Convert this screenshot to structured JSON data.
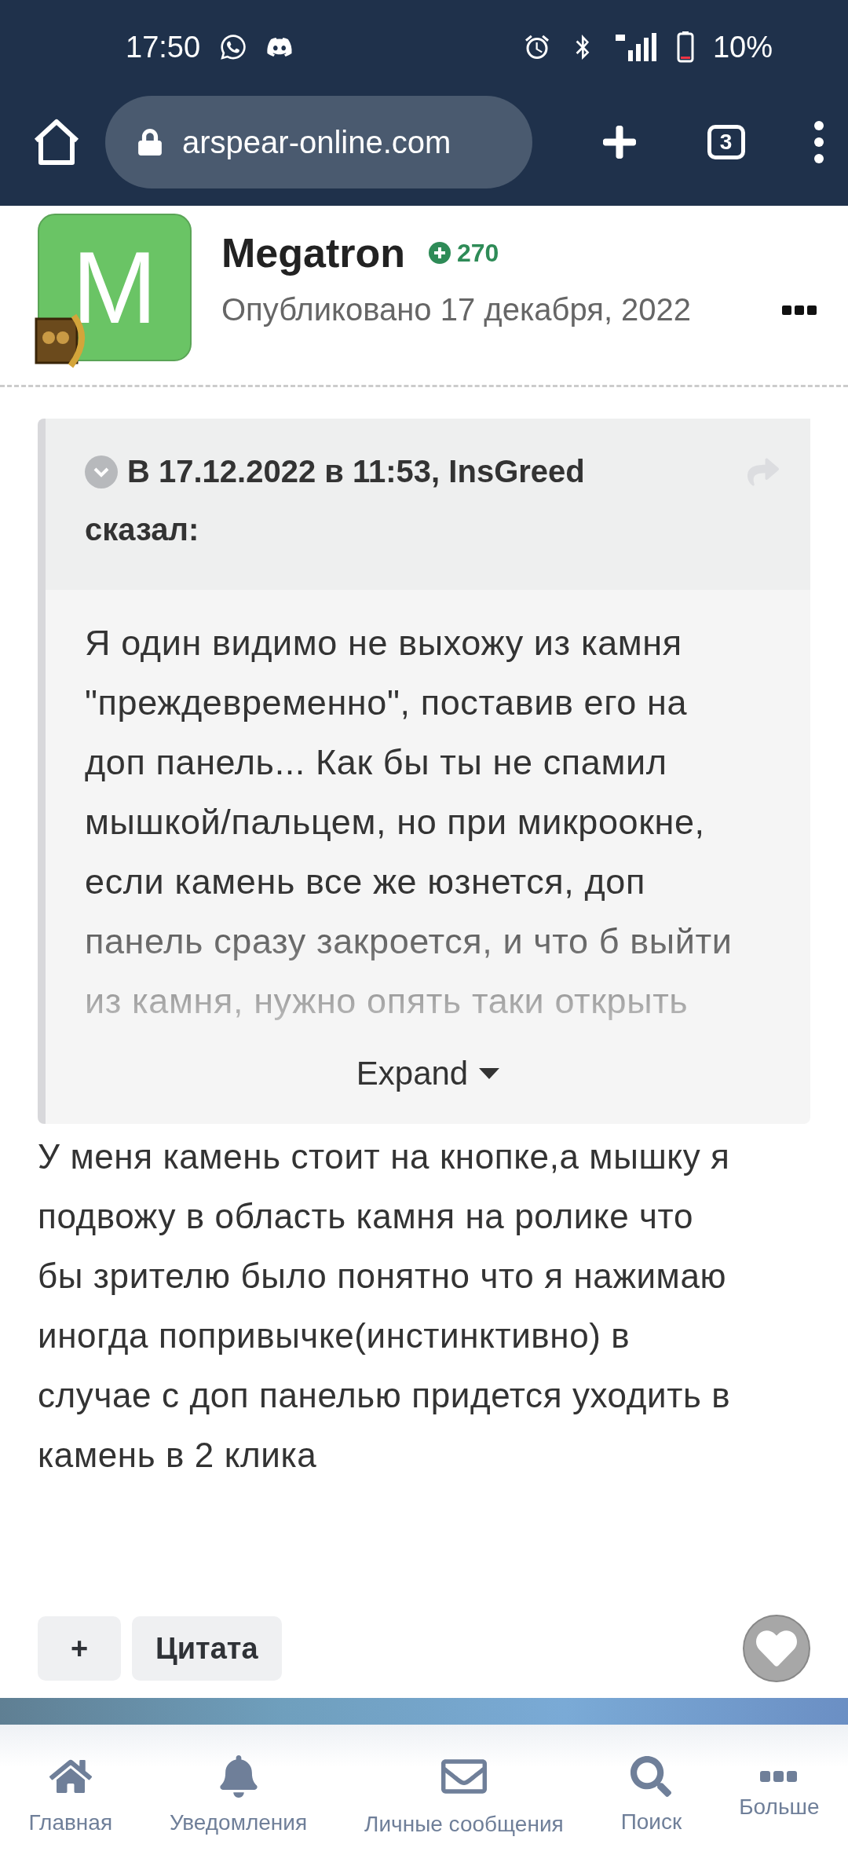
{
  "status_bar": {
    "time": "17:50",
    "battery": "10%"
  },
  "browser": {
    "url": "arspear-online.com",
    "tab_count": "3"
  },
  "post": {
    "avatar_letter": "M",
    "author": "Megatron",
    "reputation": "270",
    "published": "Опубликовано 17 декабря, 2022",
    "quote": {
      "header": "В 17.12.2022 в 11:53, InsGreed сказал:",
      "lines": [
        "Я один видимо не выхожу из камня",
        "\"преждевременно\", поставив его на",
        "доп панель... Как бы ты не спамил",
        "мышкой/пальцем, но при микроокне,",
        "если камень все же юзнется, доп",
        "панель сразу закроется, и что б выйти",
        "из камня, нужно опять таки открыть"
      ],
      "expand": "Expand"
    },
    "body_lines": [
      "У меня камень стоит на кнопке,а мышку я",
      "подвожу в область камня на ролике что",
      "бы зрителю было понятно что я нажимаю",
      "иногда попривычке(инстинктивно) в",
      "случае  с доп панелью придется уходить в",
      "камень в 2 клика"
    ],
    "actions": {
      "plus": "+",
      "quote": "Цитата"
    }
  },
  "nav": [
    {
      "kind": "home",
      "label": "Главная"
    },
    {
      "kind": "bell",
      "label": "Уведомления"
    },
    {
      "kind": "mail",
      "label": "Личные сообщения"
    },
    {
      "kind": "search",
      "label": "Поиск"
    },
    {
      "kind": "more",
      "label": "Больше"
    }
  ]
}
